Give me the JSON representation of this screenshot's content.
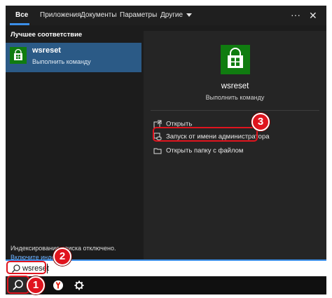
{
  "tabs": [
    {
      "label": "Все",
      "active": true
    },
    {
      "label": "Приложения"
    },
    {
      "label": "Документы"
    },
    {
      "label": "Параметры"
    },
    {
      "label": "Другие",
      "has_dropdown": true
    }
  ],
  "header": {
    "more_icon": "ellipsis-icon",
    "close_icon": "close-icon"
  },
  "left_pane": {
    "section_title": "Лучшее соответствие",
    "best_match": {
      "name": "wsreset",
      "type": "Выполнить команду",
      "icon": "store-app-icon"
    },
    "index_status": "Индексирование поиска отключено.",
    "index_link": "Включите инде..."
  },
  "right_pane": {
    "app_name": "wsreset",
    "app_type": "Выполнить команду",
    "actions": [
      {
        "label": "Открыть",
        "icon": "open-icon"
      },
      {
        "label": "Запуск от имени администратора",
        "icon": "run-as-admin-icon"
      },
      {
        "label": "Открыть папку с файлом",
        "icon": "folder-icon"
      }
    ]
  },
  "search": {
    "value": "wsreset"
  },
  "taskbar": {
    "items": [
      "search-icon",
      "yandex-browser-icon",
      "settings-gear-icon"
    ]
  },
  "annotations": {
    "step1": "1",
    "step2": "2",
    "step3": "3"
  },
  "colors": {
    "accent": "#3b8ee8",
    "highlight": "#2b5a86",
    "store_green": "#107c10",
    "annotation_red": "#e0141e"
  }
}
